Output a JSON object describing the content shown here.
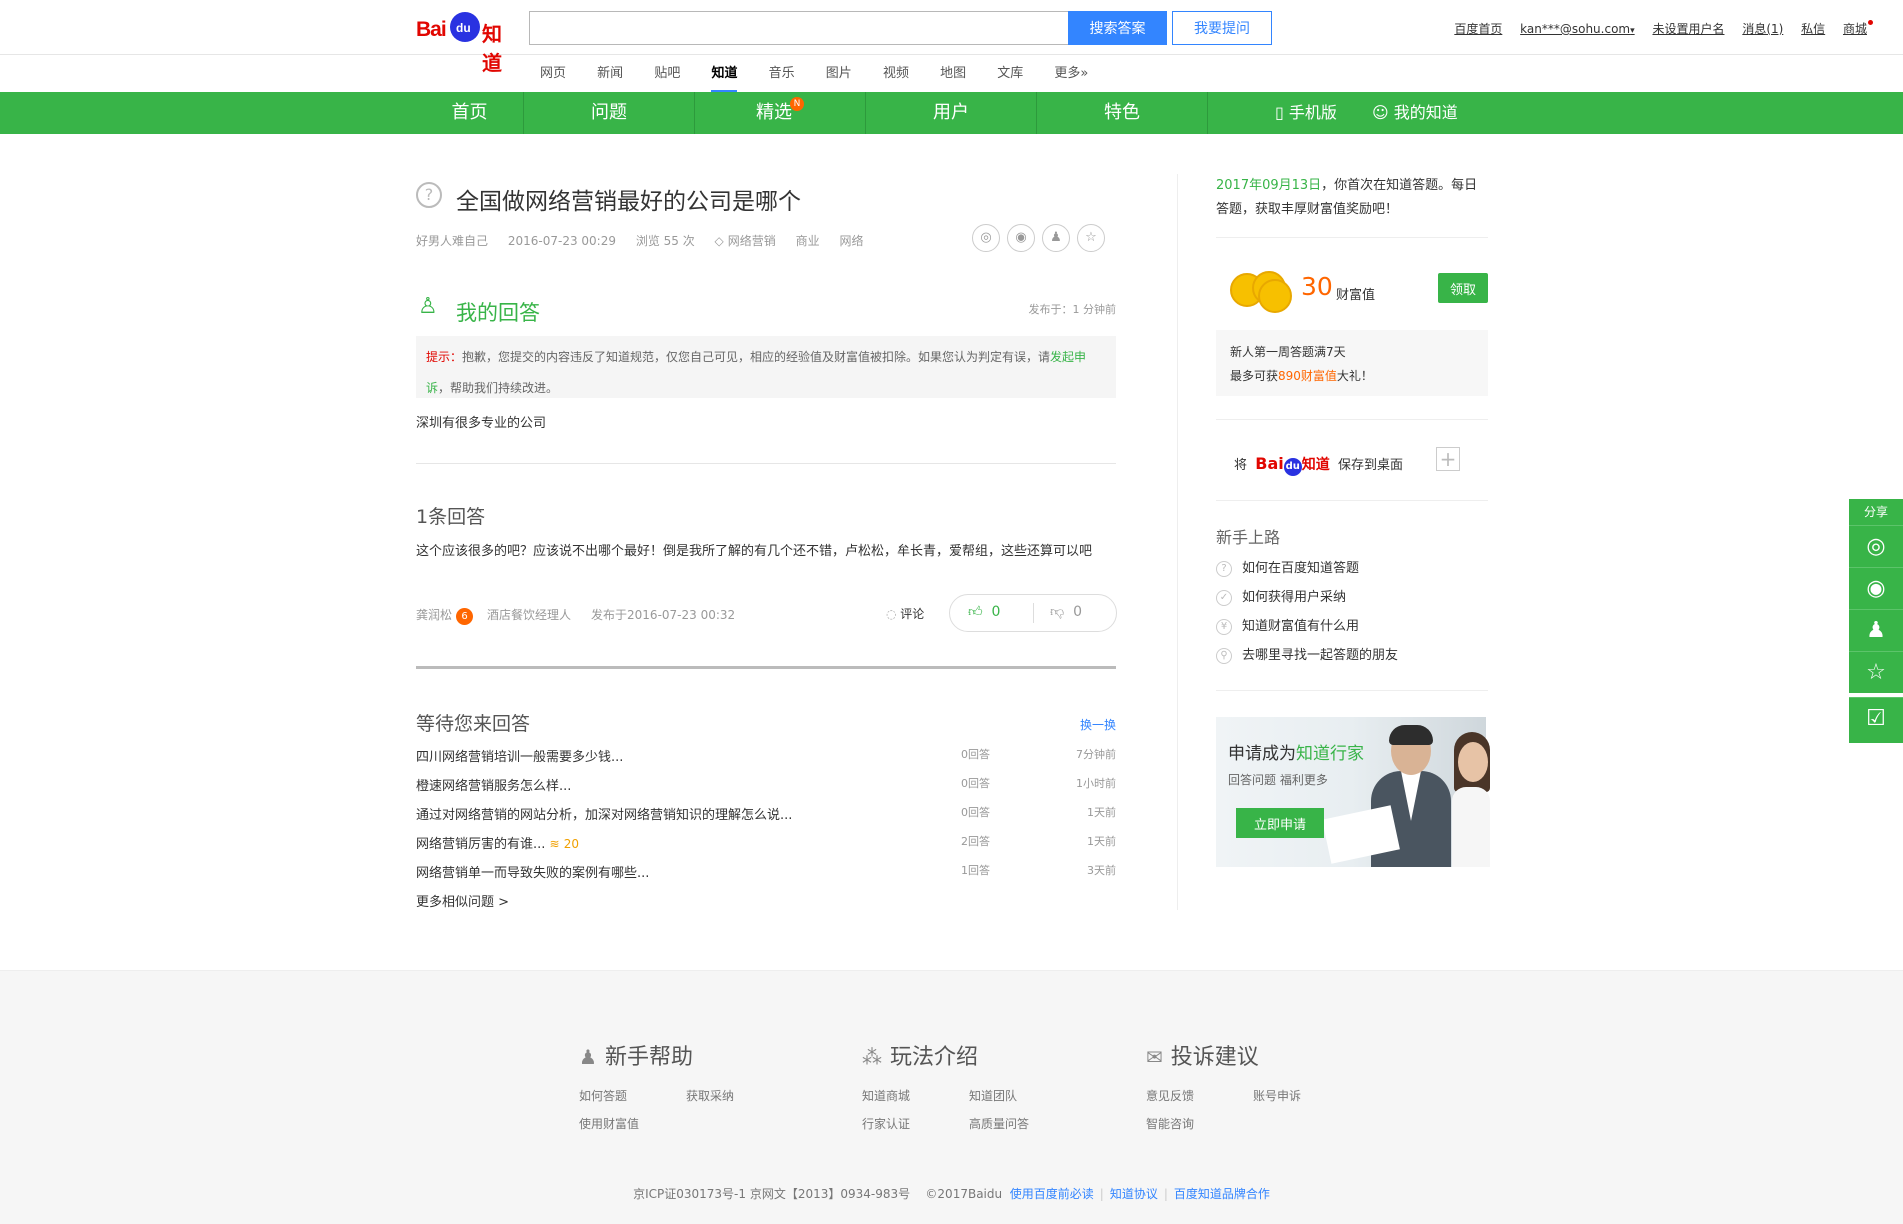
{
  "header": {
    "logo_bai": "Bai",
    "logo_du": "du",
    "logo_zhidao": "知道",
    "search_placeholder": "",
    "search_btn": "搜索答案",
    "ask_btn": "我要提问",
    "links": [
      "百度首页",
      "kan***@sohu.com",
      "未设置用户名",
      "消息(1)",
      "私信",
      "商城"
    ]
  },
  "subnav": [
    "网页",
    "新闻",
    "贴吧",
    "知道",
    "音乐",
    "图片",
    "视频",
    "地图",
    "文库",
    "更多»"
  ],
  "greennav": {
    "items": [
      "首页",
      "问题",
      "精选",
      "用户",
      "特色"
    ],
    "badge": "N",
    "mobile": "手机版",
    "my": "我的知道"
  },
  "question": {
    "title": "全国做网络营销最好的公司是哪个",
    "author": "好男人难自己",
    "date": "2016-07-23 00:29",
    "views": "浏览 55 次",
    "tags": [
      "网络营销",
      "商业",
      "网络"
    ]
  },
  "my_answer": {
    "title": "我的回答",
    "time": "发布于：1 分钟前",
    "tip_label": "提示：",
    "tip_text": "抱歉，您提交的内容违反了知道规范，仅您自己可见，相应的经验值及财富值被扣除。如果您认为判定有误，请",
    "tip_link": "发起申诉",
    "tip_end": "，帮助我们持续改进。",
    "content": "深圳有很多专业的公司"
  },
  "answers": {
    "count_label": "1条回答",
    "text": "这个应该很多的吧？应该说不出哪个最好！倒是我所了解的有几个还不错，卢松松，牟长青，爱帮组，这些还算可以吧",
    "author": "龚润松",
    "level": "6",
    "role": "酒店餐饮经理人",
    "time": "发布于2016-07-23 00:32",
    "comment": "评论",
    "up": "0",
    "down": "0"
  },
  "waiting": {
    "title": "等待您来回答",
    "refresh": "换一换",
    "rows": [
      {
        "q": "四川网络营销培训一般需要多少钱...",
        "n": "0回答",
        "t": "7分钟前",
        "coin": ""
      },
      {
        "q": "橙速网络营销服务怎么样...",
        "n": "0回答",
        "t": "1小时前",
        "coin": ""
      },
      {
        "q": "通过对网络营销的网站分析，加深对网络营销知识的理解怎么说...",
        "n": "0回答",
        "t": "1天前",
        "coin": ""
      },
      {
        "q": "网络营销厉害的有谁...",
        "n": "2回答",
        "t": "1天前",
        "coin": "20"
      },
      {
        "q": "网络营销单一而导致失败的案例有哪些...",
        "n": "1回答",
        "t": "3天前",
        "coin": ""
      }
    ],
    "more": "更多相似问题 >"
  },
  "sidebar": {
    "info_date": "2017年09月13日",
    "info_text": "，你首次在知道答题。每日答题，获取丰厚财富值奖励吧！",
    "reward_num": "30",
    "reward_label": "财富值",
    "claim": "领取",
    "new_line1": "新人第一周答题满7天",
    "new_line2a": "最多可获",
    "new_line2b": "890财富值",
    "new_line2c": "大礼！",
    "save_prefix": "将",
    "save_suffix": "保存到桌面",
    "newbie_title": "新手上路",
    "newbie_items": [
      "如何在百度知道答题",
      "如何获得用户采纳",
      "知道财富值有什么用",
      "去哪里寻找一起答题的朋友"
    ],
    "promo_t1a": "申请成为",
    "promo_t1b": "知道行家",
    "promo_t2": "回答问题  福利更多",
    "promo_btn": "立即申请"
  },
  "sharebar": {
    "label": "分享"
  },
  "footer": {
    "cols": [
      {
        "title": "新手帮助",
        "links": [
          "如何答题",
          "获取采纳",
          "使用财富值"
        ]
      },
      {
        "title": "玩法介绍",
        "links": [
          "知道商城",
          "知道团队",
          "行家认证",
          "高质量问答"
        ]
      },
      {
        "title": "投诉建议",
        "links": [
          "意见反馈",
          "账号申诉",
          "智能咨询"
        ]
      }
    ],
    "icp": "京ICP证030173号-1   京网文【2013】0934-983号",
    "copy": "©2017Baidu",
    "links": [
      "使用百度前必读",
      "知道协议",
      "百度知道品牌合作"
    ]
  }
}
